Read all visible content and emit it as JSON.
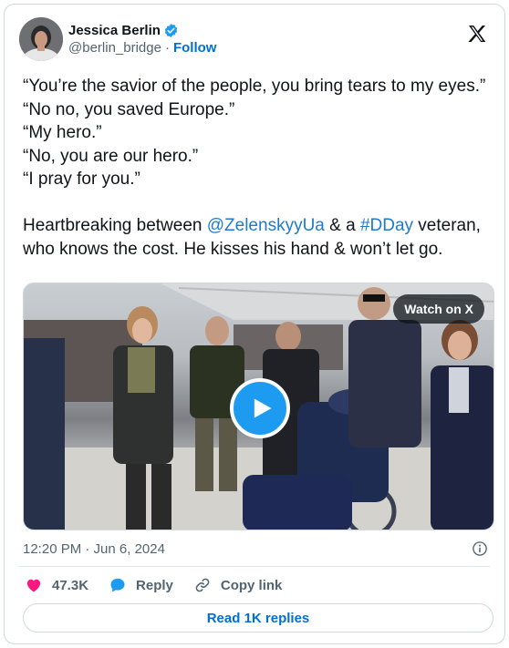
{
  "author": {
    "name": "Jessica Berlin",
    "handle": "@berlin_bridge",
    "separator": "·",
    "follow_label": "Follow"
  },
  "tweet": {
    "lines": [
      "“You’re the savior of the people, you bring tears to my eyes.”",
      "“No no, you saved Europe.”",
      "“My hero.”",
      "“No, you are our hero.”",
      "“I pray for you.”"
    ],
    "closing_prefix": "Heartbreaking between ",
    "mention": "@ZelenskyyUa",
    "closing_mid": " & a ",
    "hashtag": "#DDay",
    "closing_suffix": " veteran, who knows the cost. He kisses his hand & won’t let go."
  },
  "media": {
    "watch_label": "Watch on X",
    "play_icon": "play-icon"
  },
  "meta": {
    "timestamp": "12:20 PM · Jun 6, 2024"
  },
  "actions": {
    "likes": "47.3K",
    "reply_label": "Reply",
    "copy_label": "Copy link",
    "read_replies_label": "Read 1K replies"
  },
  "colors": {
    "link": "#1d7ad0",
    "like": "#f91880",
    "reply": "#1d9bf0",
    "verified": "#1d9bf0"
  }
}
